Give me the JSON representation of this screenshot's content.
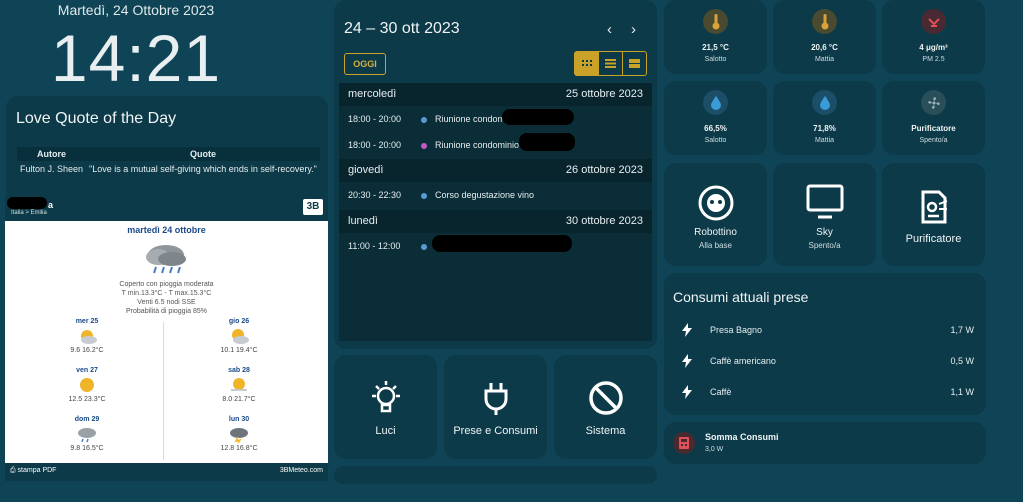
{
  "header": {
    "date": "Martedì, 24 Ottobre 2023",
    "time": "14:21"
  },
  "quote": {
    "title": "Love Quote of the Day",
    "columns": [
      "Autore",
      "Quote"
    ],
    "author": "Fulton J. Sheen",
    "text": "\"Love is a mutual self-giving which ends in self-recovery.\""
  },
  "meteo": {
    "location": "a",
    "breadcrumb": "Italia  >  Emilia",
    "logo": "3B",
    "day": "martedì 24 ottobre",
    "desc": [
      "Coperto con pioggia moderata",
      "T min.13.3°C - T max.15.3°C",
      "Venti 6.5 nodi SSE",
      "Probabilità di pioggia 85%"
    ],
    "forecast": [
      {
        "day": "mer 25",
        "temps": "9.6 16.2°C"
      },
      {
        "day": "gio 26",
        "temps": "10.1 19.4°C"
      },
      {
        "day": "ven 27",
        "temps": "12.5 23.3°C"
      },
      {
        "day": "sab 28",
        "temps": "8.0 21.7°C"
      },
      {
        "day": "dom 29",
        "temps": "9.8 16.5°C"
      },
      {
        "day": "lun 30",
        "temps": "12.8 16.8°C"
      }
    ],
    "footer_left": "stampa PDF",
    "footer_right": "3BMeteo.com"
  },
  "calendar": {
    "range": "24 – 30 ott 2023",
    "today_label": "OGGI",
    "days": [
      {
        "name": "mercoledì",
        "date": "25 ottobre 2023"
      },
      {
        "name": "giovedì",
        "date": "26 ottobre 2023"
      },
      {
        "name": "lunedì",
        "date": "30 ottobre 2023"
      }
    ],
    "events": [
      {
        "time": "18:00 - 20:00",
        "title": "Riunione condomin",
        "color": "#5b9bd5"
      },
      {
        "time": "18:00 - 20:00",
        "title": "Riunione condominio",
        "color": "#c45bc4"
      },
      {
        "time": "20:30 - 22:30",
        "title": "Corso degustazione vino",
        "color": "#5b9bd5"
      },
      {
        "time": "11:00 - 12:00",
        "title": "",
        "color": "#5b9bd5"
      }
    ]
  },
  "buttons": {
    "luci": "Luci",
    "prese": "Prese e Consumi",
    "sistema": "Sistema"
  },
  "sensors": [
    {
      "value": "21,5 °C",
      "label": "Salotto"
    },
    {
      "value": "20,6 °C",
      "label": "Mattia"
    },
    {
      "value": "4 μg/m³",
      "label": "PM 2.5"
    },
    {
      "value": "66,5%",
      "label": "Salotto"
    },
    {
      "value": "71,8%",
      "label": "Mattia"
    },
    {
      "value": "Purificatore",
      "label": "Spento/a"
    }
  ],
  "devices": [
    {
      "name": "Robottino",
      "state": "Alla base"
    },
    {
      "name": "Sky",
      "state": "Spento/a"
    },
    {
      "name": "Purificatore",
      "state": ""
    }
  ],
  "consumi": {
    "title": "Consumi attuali prese",
    "rows": [
      {
        "name": "Presa Bagno",
        "value": "1,7 W"
      },
      {
        "name": "Caffè americano",
        "value": "0,5 W"
      },
      {
        "name": "Caffè",
        "value": "1,1 W"
      }
    ],
    "sum_name": "Somma Consumi",
    "sum_value": "3,0 W"
  },
  "colors": {
    "accent": "#c9a227",
    "temp": "#d9a23a",
    "water": "#3a9bd9",
    "pm": "#e0505a"
  }
}
